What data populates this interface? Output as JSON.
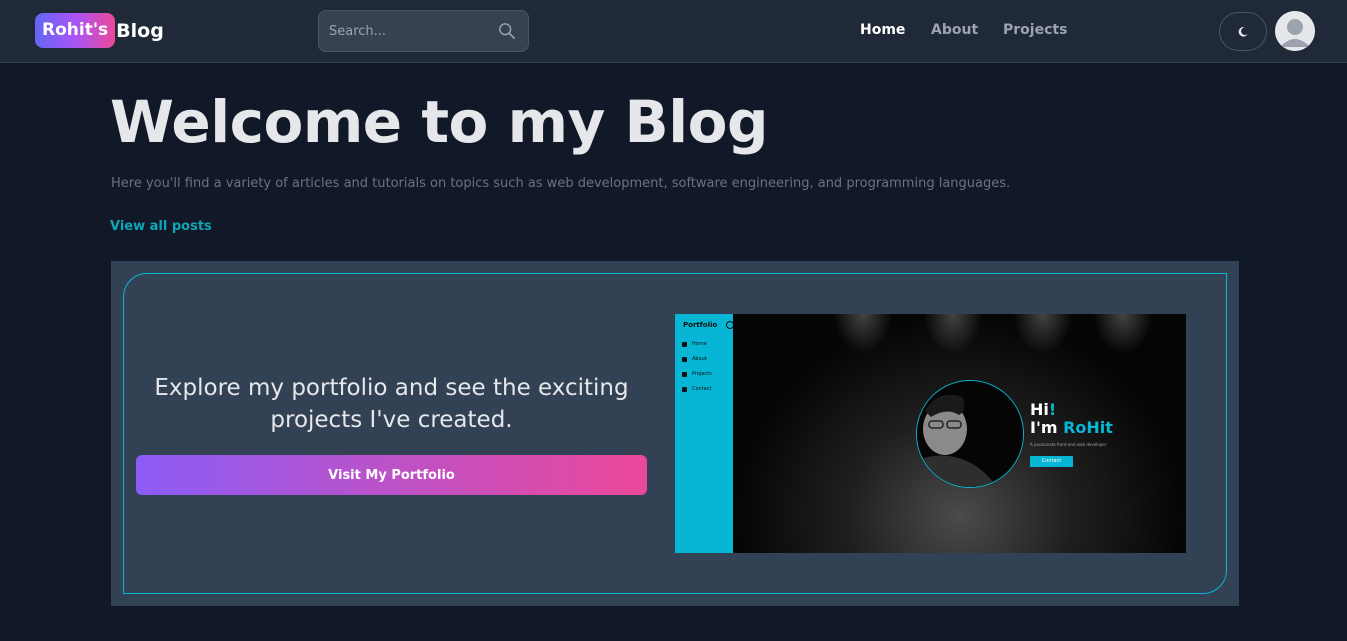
{
  "navbar": {
    "brand_pill": "Rohit's",
    "brand_text": "Blog",
    "search_placeholder": "Search...",
    "links": [
      {
        "label": "Home",
        "active": true
      },
      {
        "label": "About",
        "active": false
      },
      {
        "label": "Projects",
        "active": false
      }
    ],
    "icons": {
      "search": "search-icon",
      "theme": "moon-icon",
      "avatar": "user-avatar-icon"
    }
  },
  "hero": {
    "title": "Welcome to my Blog",
    "description": "Here you'll find a variety of articles and tutorials on topics such as web development, software engineering, and programming languages.",
    "view_all": "View all posts"
  },
  "portfolio_card": {
    "text": "Explore my portfolio and see the exciting projects I've created.",
    "button": "Visit My Portfolio",
    "preview": {
      "logo": "Portfolio",
      "nav": [
        "Home",
        "About",
        "Projects",
        "Contact"
      ],
      "hi_text": "Hi",
      "hi_mark": "!",
      "im_text": "I'm ",
      "name": "RoHit",
      "subtitle": "A passionate front-end web developer",
      "contact_button": "Contact"
    }
  },
  "colors": {
    "background": "#111827",
    "navbar": "#1f2937",
    "accent_cyan": "#06b6d4",
    "gradient_start": "#8b5cf6",
    "gradient_end": "#ec4899",
    "card": "#334155"
  }
}
